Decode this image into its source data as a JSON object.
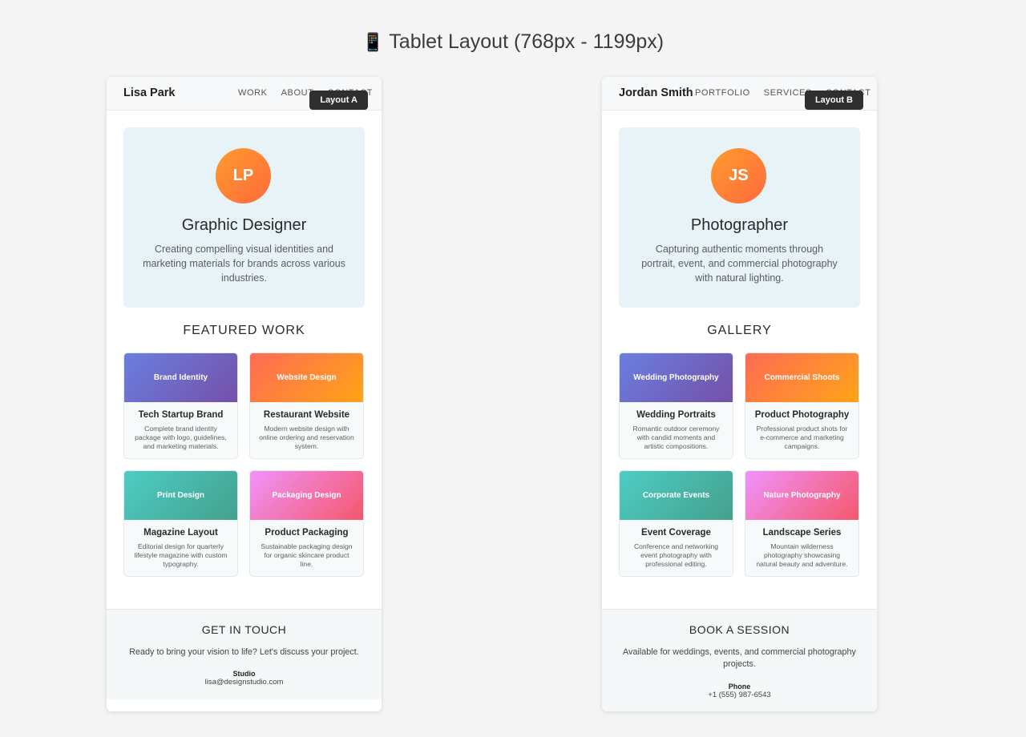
{
  "heading": {
    "icon": "📱",
    "text": "Tablet Layout (768px - 1199px)"
  },
  "layouts": [
    {
      "badge": "Layout A",
      "brand": "Lisa Park",
      "nav": [
        "WORK",
        "ABOUT",
        "CONTACT"
      ],
      "hero": {
        "initials": "LP",
        "title": "Graphic Designer",
        "description": "Creating compelling visual identities and marketing materials for brands across various industries."
      },
      "section_title": "FEATURED WORK",
      "cards": [
        {
          "banner": "Brand Identity",
          "title": "Tech Startup Brand",
          "description": "Complete brand identity package with logo, guidelines, and marketing materials."
        },
        {
          "banner": "Website Design",
          "title": "Restaurant Website",
          "description": "Modern website design with online ordering and reservation system."
        },
        {
          "banner": "Print Design",
          "title": "Magazine Layout",
          "description": "Editorial design for quarterly lifestyle magazine with custom typography."
        },
        {
          "banner": "Packaging Design",
          "title": "Product Packaging",
          "description": "Sustainable packaging design for organic skincare product line."
        }
      ],
      "contact": {
        "title": "GET IN TOUCH",
        "text": "Ready to bring your vision to life? Let's discuss your project.",
        "label": "Studio",
        "value": "lisa@designstudio.com"
      }
    },
    {
      "badge": "Layout B",
      "brand": "Jordan Smith",
      "nav": [
        "PORTFOLIO",
        "SERVICES",
        "CONTACT"
      ],
      "hero": {
        "initials": "JS",
        "title": "Photographer",
        "description": "Capturing authentic moments through portrait, event, and commercial photography with natural lighting."
      },
      "section_title": "GALLERY",
      "cards": [
        {
          "banner": "Wedding Photography",
          "title": "Wedding Portraits",
          "description": "Romantic outdoor ceremony with candid moments and artistic compositions."
        },
        {
          "banner": "Commercial Shoots",
          "title": "Product Photography",
          "description": "Professional product shots for e-commerce and marketing campaigns."
        },
        {
          "banner": "Corporate Events",
          "title": "Event Coverage",
          "description": "Conference and networking event photography with professional editing."
        },
        {
          "banner": "Nature Photography",
          "title": "Landscape Series",
          "description": "Mountain wilderness photography showcasing natural beauty and adventure."
        }
      ],
      "contact": {
        "title": "BOOK A SESSION",
        "text": "Available for weddings, events, and commercial photography projects.",
        "label": "Phone",
        "value": "+1 (555) 987-6543"
      }
    }
  ]
}
